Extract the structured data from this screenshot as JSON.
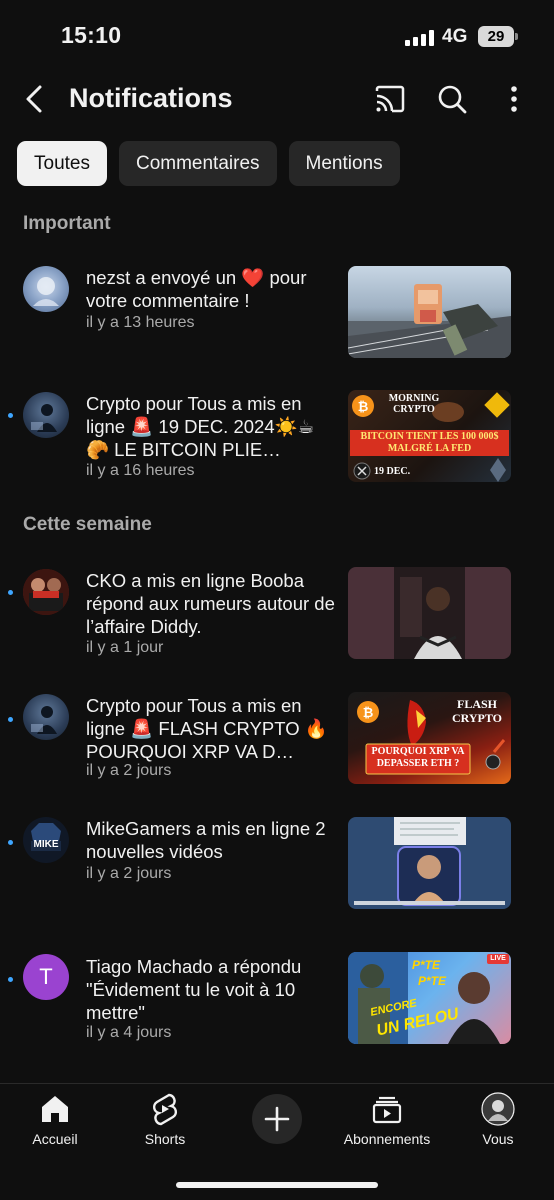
{
  "status_bar": {
    "time": "15:10",
    "network": "4G",
    "battery": "29"
  },
  "header": {
    "title": "Notifications",
    "icons": [
      "back-arrow-icon",
      "cast-icon",
      "search-icon",
      "more-vert-icon"
    ]
  },
  "filters": {
    "chips": [
      {
        "label": "Toutes",
        "active": true
      },
      {
        "label": "Commentaires",
        "active": false
      },
      {
        "label": "Mentions",
        "active": false
      }
    ]
  },
  "sections": {
    "important": "Important",
    "this_week": "Cette semaine"
  },
  "notifications": [
    {
      "text": "nezst a envoyé un ❤️ pour votre commentaire !",
      "time": "il y a 13 heures",
      "unread": false
    },
    {
      "text": "Crypto pour Tous a mis en ligne 🚨 19 DEC. 2024☀️☕🥐 LE BITCOIN PLIE…",
      "time": "il y a 16 heures",
      "unread": true
    },
    {
      "text": "CKO a mis en ligne Booba répond aux rumeurs autour de l’affaire Diddy.",
      "time": "il y a 1 jour",
      "unread": true
    },
    {
      "text": "Crypto pour Tous a mis en ligne 🚨 FLASH CRYPTO 🔥 POURQUOI XRP VA D…",
      "time": "il y a 2 jours",
      "unread": true
    },
    {
      "text": "MikeGamers a mis en ligne 2 nouvelles vidéos",
      "time": "il y a 2 jours",
      "unread": true
    },
    {
      "text": "Tiago Machado a répondu \"Évidement tu le voit à 10 mettre\"",
      "time": "il y a 4 jours",
      "unread": true,
      "avatar_letter": "T"
    }
  ],
  "thumbnails": {
    "crypto1": {
      "badge": "MORNING CRYPTO",
      "headline": "BITCOIN TIENT LES 100 000$ MALGRÉ LA FED",
      "date": "19 DEC."
    },
    "crypto2": {
      "title": "FLASH CRYPTO",
      "headline": "POURQUOI XRP VA DEPASSER ETH ?"
    },
    "mike": {
      "logo": "MIKE"
    },
    "tiago": {
      "live": "LIVE",
      "caption1": "ENCORE",
      "caption2": "UN RELOU",
      "p1": "P*TE"
    }
  },
  "bottom_nav": {
    "items": [
      {
        "label": "Accueil",
        "icon": "home-icon"
      },
      {
        "label": "Shorts",
        "icon": "shorts-icon"
      },
      {
        "label": "",
        "icon": "create-plus-icon"
      },
      {
        "label": "Abonnements",
        "icon": "subscriptions-icon"
      },
      {
        "label": "Vous",
        "icon": "profile-avatar-icon"
      }
    ]
  },
  "colors": {
    "background": "#0f0f0f",
    "chip": "#272727",
    "unread_dot": "#3ea6ff",
    "secondary_text": "#aaaaaa"
  }
}
